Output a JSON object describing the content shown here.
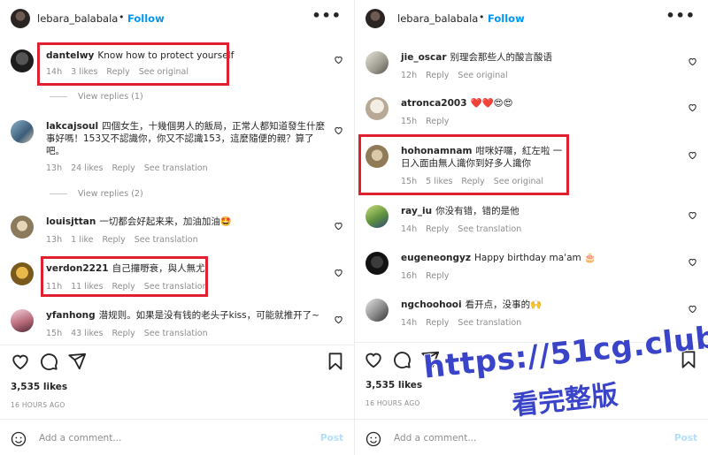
{
  "header": {
    "username": "lebara_balabala",
    "dot": "•",
    "follow": "Follow",
    "more": "•••"
  },
  "left": {
    "comments": [
      {
        "user": "dantelwy",
        "text": "Know how to protect yourself",
        "time": "14h",
        "likes": "3 likes",
        "reply": "Reply",
        "extra": "See original"
      },
      {
        "user": "lakcajsoul",
        "text": "四個女生，十幾個男人的飯局，正常人都知道發生什麼事好嗎！153又不認識你，你又不認識153，這麼隨便的親？算了吧。",
        "time": "13h",
        "likes": "24 likes",
        "reply": "Reply",
        "extra": "See translation"
      },
      {
        "user": "louisjttan",
        "text": "一切都会好起来来，加油加油🤩",
        "time": "13h",
        "likes": "1 like",
        "reply": "Reply",
        "extra": "See translation"
      },
      {
        "user": "verdon2221",
        "text": "自己攞嘢衰，與人無尤",
        "time": "11h",
        "likes": "11 likes",
        "reply": "Reply",
        "extra": "See translation"
      },
      {
        "user": "yfanhong",
        "text": "潜规则。如果是没有钱的老头子kiss，可能就推开了~",
        "time": "15h",
        "likes": "43 likes",
        "reply": "Reply",
        "extra": "See translation"
      }
    ],
    "view_replies_1": "View replies (1)",
    "view_replies_2": "View replies (2)",
    "likes": "3,535 likes",
    "age": "16 HOURS AGO",
    "add_comment_placeholder": "Add a comment...",
    "post": "Post"
  },
  "right": {
    "comments": [
      {
        "user": "jie_oscar",
        "text": "别理会那些人的酸言酸语",
        "time": "12h",
        "likes": "",
        "reply": "Reply",
        "extra": "See original"
      },
      {
        "user": "atronca2003",
        "text": "❤️❤️😍😍",
        "time": "15h",
        "likes": "",
        "reply": "Reply",
        "extra": ""
      },
      {
        "user": "hohonamnam",
        "text": "咁咪好囉，紅左啦 一日入面由無人識你到好多人識你",
        "time": "15h",
        "likes": "5 likes",
        "reply": "Reply",
        "extra": "See original"
      },
      {
        "user": "ray_iu",
        "text": "你没有错，错的是他",
        "time": "14h",
        "likes": "",
        "reply": "Reply",
        "extra": "See translation"
      },
      {
        "user": "eugeneongyz",
        "text": "Happy birthday ma'am 🎂",
        "time": "16h",
        "likes": "",
        "reply": "Reply",
        "extra": ""
      },
      {
        "user": "ngchoohooi",
        "text": "看开点，没事的🙌",
        "time": "14h",
        "likes": "",
        "reply": "Reply",
        "extra": "See translation"
      }
    ],
    "likes": "3,535 likes",
    "age": "16 HOURS AGO",
    "add_comment_placeholder": "Add a comment...",
    "post": "Post"
  },
  "watermark": {
    "url": "https://51cg.club",
    "text": "看完整版"
  },
  "colors": {
    "highlight": "#e0202e",
    "follow": "#0095f6",
    "watermark": "#3a44c9",
    "muted": "#8e8e8e"
  },
  "icons": [
    "heart-icon",
    "comment-icon",
    "share-icon",
    "bookmark-icon",
    "emoji-icon",
    "more-icon"
  ]
}
